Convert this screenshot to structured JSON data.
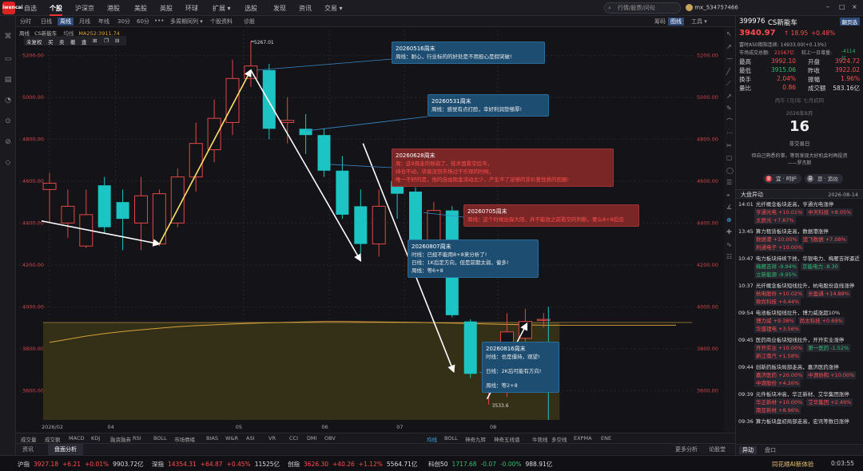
{
  "nav": {
    "logo": "iwencai",
    "items": [
      "自选",
      "个股",
      "沪深京",
      "港股",
      "美股",
      "英股",
      "环球",
      "扩展 ▾",
      "选股",
      "发现",
      "资讯",
      "交易 ▾"
    ],
    "active_index": 1,
    "search_placeholder": "行情/股票/问句",
    "user": "mx_534757466",
    "window_controls": [
      "–",
      "□",
      "×"
    ]
  },
  "period_tabs": {
    "items": [
      "分时",
      "日线",
      "周线",
      "月线",
      "年线",
      "30分",
      "60分",
      "•••",
      "多周期同列 ▾",
      "个股资料",
      "诊股"
    ],
    "active_index": 2,
    "right_items": [
      "筹码",
      "图线",
      "工具 ▾"
    ]
  },
  "chart_header": {
    "period": "周线",
    "name": "CS新能车",
    "ma_label": "均线",
    "ma_value": "MA252:3911.74"
  },
  "unbound_toolbar": [
    "未复权",
    "买",
    "卖",
    "撤",
    "査",
    "⊞",
    "❐",
    "⊟"
  ],
  "chart_data": {
    "type": "candlestick",
    "yticks": [
      3600,
      3800,
      4000,
      4200,
      4400,
      4600,
      4800,
      5000,
      5200
    ],
    "ylim": [
      3460,
      5320
    ],
    "xticks": [
      "2026/02",
      "04",
      "05",
      "06",
      "07",
      "08"
    ],
    "high_label": "5267.01",
    "low_label": "3533.6",
    "candles": [
      {
        "o": 4560,
        "c": 4590,
        "h": 4640,
        "l": 4400
      },
      {
        "o": 4400,
        "c": 4480,
        "h": 4560,
        "l": 4330
      },
      {
        "o": 4290,
        "c": 4440,
        "h": 4560,
        "l": 4280
      },
      {
        "o": 4580,
        "c": 4380,
        "h": 4620,
        "l": 4350
      },
      {
        "o": 4500,
        "c": 4420,
        "h": 4560,
        "l": 4270
      },
      {
        "o": 4400,
        "c": 4530,
        "h": 4620,
        "l": 4270
      },
      {
        "o": 4300,
        "c": 4540,
        "h": 4560,
        "l": 4290
      },
      {
        "o": 4400,
        "c": 4620,
        "h": 4660,
        "l": 4380
      },
      {
        "o": 4620,
        "c": 4780,
        "h": 4880,
        "l": 4550
      },
      {
        "o": 4750,
        "c": 4900,
        "h": 4990,
        "l": 4690
      },
      {
        "o": 4880,
        "c": 5090,
        "h": 5180,
        "l": 4820
      },
      {
        "o": 5090,
        "c": 5150,
        "h": 5267,
        "l": 5050
      },
      {
        "o": 5130,
        "c": 4850,
        "h": 5160,
        "l": 4800
      },
      {
        "o": 4880,
        "c": 4890,
        "h": 5000,
        "l": 4780
      },
      {
        "o": 4850,
        "c": 4820,
        "h": 4920,
        "l": 4730
      },
      {
        "o": 4820,
        "c": 4650,
        "h": 4850,
        "l": 4620
      },
      {
        "o": 4650,
        "c": 4440,
        "h": 4720,
        "l": 4420
      },
      {
        "o": 4480,
        "c": 4300,
        "h": 4560,
        "l": 4250
      },
      {
        "o": 4300,
        "c": 4480,
        "h": 4560,
        "l": 4240
      },
      {
        "o": 4600,
        "c": 4540,
        "h": 4690,
        "l": 4420
      },
      {
        "o": 4550,
        "c": 4210,
        "h": 4570,
        "l": 4180
      },
      {
        "o": 4210,
        "c": 4460,
        "h": 4500,
        "l": 4180
      },
      {
        "o": 4460,
        "c": 3960,
        "h": 4480,
        "l": 3950
      },
      {
        "o": 3930,
        "c": 3680,
        "h": 3940,
        "l": 3660
      },
      {
        "o": 3690,
        "c": 3800,
        "h": 3830,
        "l": 3533
      },
      {
        "o": 3780,
        "c": 3880,
        "h": 3970,
        "l": 3570
      },
      {
        "o": 3850,
        "c": 3930,
        "h": 3990,
        "l": 3780
      },
      {
        "o": 3935,
        "c": 3940,
        "h": 3970,
        "l": 3900
      }
    ],
    "ma252": [
      3830,
      3845,
      3860,
      3872,
      3882,
      3890,
      3898,
      3905,
      3910,
      3914,
      3918,
      3921,
      3924,
      3926,
      3928,
      3930,
      3930,
      3929,
      3928,
      3927,
      3926,
      3924,
      3922,
      3920,
      3918,
      3916,
      3914,
      3912
    ]
  },
  "annotations": [
    {
      "id": "n1",
      "color": "blue",
      "title": "20260516周末",
      "lines": [
        "周线：耐心，行业标的的好处是不用担心是假突破!"
      ]
    },
    {
      "id": "n2",
      "color": "blue",
      "title": "20260531周末",
      "lines": [
        "周线：感觉有点打脸，幸好利润垫够厚!"
      ]
    },
    {
      "id": "n3",
      "color": "red",
      "title": "20260628周末",
      "lines": [
        "周：这8周走的够弱了，技术面看空后市，",
        "持仓不动，毕竟没到市场过于乐观的时候，",
        "唯一不好的是，他的自由现金流动太少，产生不了足够的非价差性质的回报!"
      ]
    },
    {
      "id": "n4",
      "color": "red",
      "title": "20260705周末",
      "lines": [
        "周线：这个时候出探大阳，并不能改之前看空的判断，要么8+8后见"
      ]
    },
    {
      "id": "n5",
      "color": "blue",
      "title": "20260807周末",
      "lines": [
        "时线：已经不能用8+8来分析了!",
        "日线：1K后定方向，但是前期太弱，偏多!",
        "周线：等6+8"
      ]
    },
    {
      "id": "n6",
      "color": "blue",
      "title": "20260816周末",
      "lines": [
        "时线：也是僵持，观望!",
        "",
        "日线：2K后可能有方向!",
        "",
        "周线：等2+8"
      ]
    }
  ],
  "indicators": [
    "成交量",
    "成交额",
    "MACD",
    "KDJ",
    "融资融券",
    "RSI",
    "BOLL",
    "市场情绪",
    "BIAS",
    "W&R",
    "ASI",
    "VR",
    "CCI",
    "DMI",
    "OBV"
  ],
  "overlay_indicators": [
    "均线",
    "BOLL",
    "神奇九转",
    "神奇五线谱",
    "牛熊线",
    "多空线",
    "EXPMA",
    "ENE"
  ],
  "bottom_tabs": [
    "资讯",
    "盘面分析"
  ],
  "bottom_tabs_active": 1,
  "bottom_right": [
    "更多分析",
    "论股堂"
  ],
  "ticker": [
    {
      "name": "沪指",
      "price": "3927.18",
      "chg": "+6.21",
      "pct": "+0.01%",
      "amt": "9903.72亿"
    },
    {
      "name": "深指",
      "price": "14354.31",
      "chg": "+64.87",
      "pct": "+0.45%",
      "amt": "11525亿"
    },
    {
      "name": "创指",
      "price": "3626.30",
      "chg": "+40.26",
      "pct": "+1.12%",
      "amt": "5564.71亿"
    },
    {
      "name": "科创50",
      "price": "1717.68",
      "chg": "-0.07",
      "pct": "-0.00%",
      "amt": "988.91亿"
    }
  ],
  "ticker_right": {
    "text": "同花顺AI新体验",
    "time": "0:03:55"
  },
  "right_panel": {
    "code": "399976",
    "name": "CS新能车",
    "button": "翻页选",
    "price": "3940.97",
    "chg": "↑ 18.95",
    "pct": "+0.48%",
    "sub1": "富时A50期指连续: 14933.00(+0.13%)",
    "sub2_label": "市场成交总额:",
    "sub2_value": "21567亿",
    "sub2_label2": "较上一日增量:",
    "sub2_value2": "-4114亿",
    "quotes": [
      {
        "k1": "最高",
        "v1": "3992.10",
        "k2": "开盘",
        "v2": "3924.72"
      },
      {
        "k1": "最低",
        "v1": "3915.06",
        "k2": "昨收",
        "v2": "3922.02"
      },
      {
        "k1": "换手",
        "v1": "2.04%",
        "k2": "振幅",
        "v2": "1.96%"
      },
      {
        "k1": "量比",
        "v1": "0.86",
        "k2": "成交额",
        "v2": "583.16亿"
      }
    ],
    "lunar": "丙午 [马]年 七月初四",
    "cal_month": "2026年8月",
    "cal_day": "16",
    "cal_note": "非交易日",
    "quote_text": "但自己熟悉的事，等到发现大好机会时再投资",
    "quote_author": "——罗杰斯",
    "pills": [
      "宜 · 呵护",
      "忌 · 追凶"
    ],
    "alerts_title": "大盘异动",
    "alerts_date": "2026-08-14",
    "alerts": [
      {
        "time": "14:01",
        "text": "光纤概念板块走高，亨通光电涨停",
        "chips": [
          [
            "亨通光电",
            "+10.01%",
            "r"
          ],
          [
            "中天科技",
            "+8.05%",
            "r"
          ],
          [
            "太辰光",
            "+7.87%",
            "r"
          ]
        ]
      },
      {
        "time": "13:45",
        "text": "算力租赁板块走高，数据港涨停",
        "chips": [
          [
            "数据港",
            "+10.00%",
            "r"
          ],
          [
            "莲飞数据",
            "+7.08%",
            "r"
          ],
          [
            "利通电子",
            "+10.00%",
            "r"
          ]
        ]
      },
      {
        "time": "10:47",
        "text": "电力板块持续下挫，华银电力、梅雁吉祥逼近",
        "chips": [
          [
            "梅雁吉祥",
            "-9.94%",
            "g"
          ],
          [
            "京能电力",
            "-8.30",
            "g"
          ],
          [
            "立新能源",
            "-9.95%",
            "g"
          ]
        ]
      },
      {
        "time": "10:37",
        "text": "光纤概念板块短线拉升，杭电股份直线涨停",
        "chips": [
          [
            "杭电股份",
            "+10.02%",
            "r"
          ],
          [
            "长盈通",
            "+14.88%",
            "r"
          ],
          [
            "致尚科技",
            "+4.44%",
            "r"
          ]
        ]
      },
      {
        "time": "09:54",
        "text": "电池板块短线拉升，博力威涨超10%",
        "chips": [
          [
            "博力威",
            "+9.38%",
            "r"
          ],
          [
            "尚太科技",
            "+0.69%",
            "r"
          ],
          [
            "华盛锂电",
            "+3.56%",
            "r"
          ]
        ]
      },
      {
        "time": "09:45",
        "text": "医药商业板块短线拉升，开开实业涨停",
        "chips": [
          [
            "开开实业",
            "+10.00%",
            "r"
          ],
          [
            "第一医药",
            "-1.52%",
            "g"
          ],
          [
            "新江南汽",
            "+1.58%",
            "r"
          ]
        ]
      },
      {
        "time": "09:44",
        "text": "创新药板块局部走高，嘉济医药涨停",
        "chips": [
          [
            "嘉济医药",
            "+20.00%",
            "r"
          ],
          [
            "中源协和",
            "+10.00%",
            "r"
          ],
          [
            "中源股份",
            "+4.26%",
            "r"
          ]
        ]
      },
      {
        "time": "09:39",
        "text": "元件板块冲高，华正新材、艾华集团涨停",
        "chips": [
          [
            "华正新材",
            "+10.00%",
            "r"
          ],
          [
            "艾华集团",
            "+2.49%",
            "r"
          ],
          [
            "南亚新材",
            "+8.96%",
            "r"
          ]
        ]
      },
      {
        "time": "09:36",
        "text": "算力板块盘初局部走高，宏讯等数日涨停",
        "chips": []
      }
    ],
    "bottom_tabs": [
      "异动",
      "盘口"
    ]
  }
}
